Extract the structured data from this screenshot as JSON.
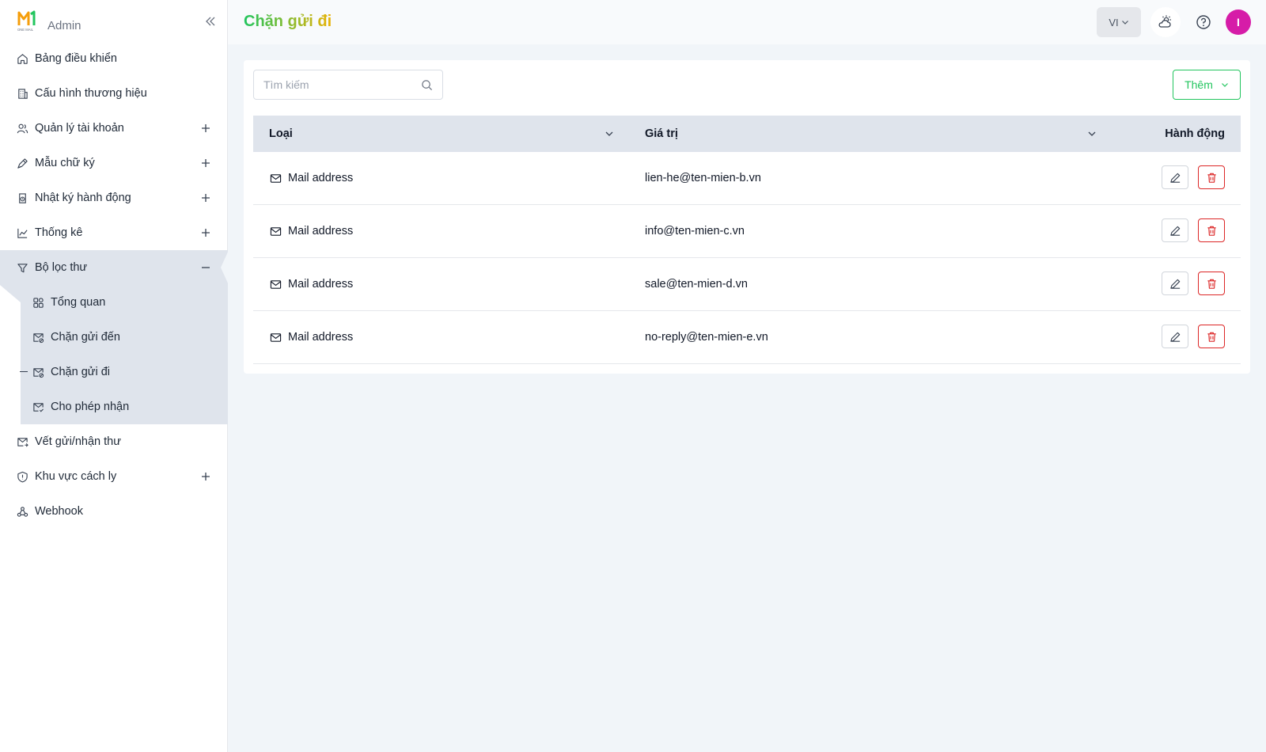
{
  "brand": {
    "logo_text": "ONE MAIL",
    "label": "Admin"
  },
  "sidebar": {
    "items": [
      {
        "label": "Bảng điều khiển",
        "icon": "home-icon",
        "expandable": false
      },
      {
        "label": "Cấu hình thương hiệu",
        "icon": "building-icon",
        "expandable": false
      },
      {
        "label": "Quản lý tài khoản",
        "icon": "users-icon",
        "expandable": true
      },
      {
        "label": "Mẫu chữ ký",
        "icon": "signature-pen-icon",
        "expandable": true
      },
      {
        "label": "Nhật ký hành động",
        "icon": "log-icon",
        "expandable": true
      },
      {
        "label": "Thống kê",
        "icon": "chart-icon",
        "expandable": true
      },
      {
        "label": "Bộ lọc thư",
        "icon": "filter-icon",
        "expandable": true,
        "expanded": true
      },
      {
        "label": "Vết gửi/nhận thư",
        "icon": "mail-trace-icon",
        "expandable": false
      },
      {
        "label": "Khu vực cách ly",
        "icon": "shield-icon",
        "expandable": true
      },
      {
        "label": "Webhook",
        "icon": "webhook-icon",
        "expandable": false
      }
    ],
    "submenu": [
      {
        "label": "Tổng quan",
        "icon": "dashboard-grid-icon"
      },
      {
        "label": "Chặn gửi đến",
        "icon": "mail-block-icon"
      },
      {
        "label": "Chặn gửi đi",
        "icon": "mail-block-icon",
        "active": true
      },
      {
        "label": "Cho phép nhận",
        "icon": "mail-allow-icon"
      }
    ]
  },
  "header": {
    "title": "Chặn gửi đi",
    "language": "VI",
    "avatar_initial": "I"
  },
  "toolbar": {
    "search_placeholder": "Tìm kiếm",
    "add_label": "Thêm"
  },
  "table": {
    "columns": [
      "Loại",
      "Giá trị",
      "Hành động"
    ],
    "rows": [
      {
        "type": "Mail address",
        "value": "lien-he@ten-mien-b.vn"
      },
      {
        "type": "Mail address",
        "value": "info@ten-mien-c.vn"
      },
      {
        "type": "Mail address",
        "value": "sale@ten-mien-d.vn"
      },
      {
        "type": "Mail address",
        "value": "no-reply@ten-mien-e.vn"
      }
    ]
  },
  "colors": {
    "accent_green": "#22c55e",
    "danger_red": "#dc2626",
    "avatar_bg": "#d61ca8",
    "active_bg": "#dfe4ec"
  }
}
